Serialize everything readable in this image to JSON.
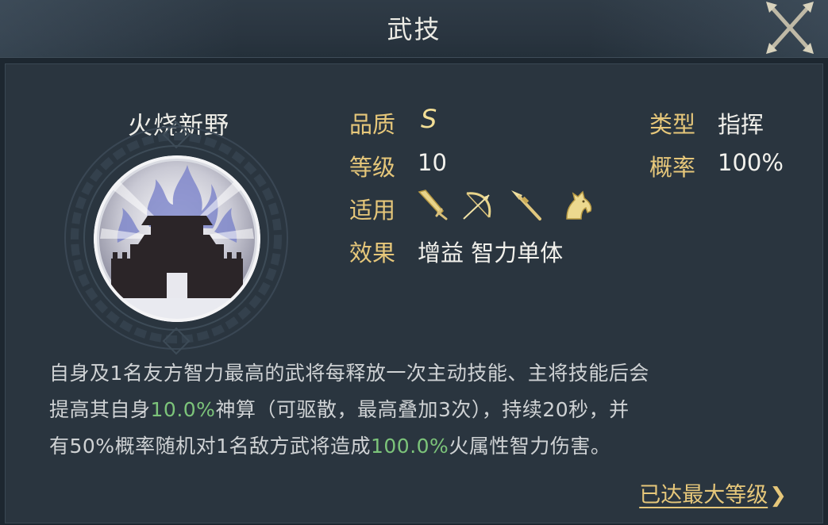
{
  "header": {
    "title": "武技"
  },
  "skill": {
    "name": "火烧新野",
    "quality_label": "品质",
    "quality": "S",
    "level_label": "等级",
    "level": "10",
    "applies_label": "适用",
    "effect_label": "效果",
    "effect": "增益 智力单体",
    "type_label": "类型",
    "type": "指挥",
    "rate_label": "概率",
    "rate": "100%",
    "weapons": [
      "sword-icon",
      "bow-icon",
      "spear-icon",
      "horse-icon"
    ]
  },
  "description": {
    "line1": "自身及1名友方智力最高的武将每释放一次主动技能、主将技能后会",
    "line2_a": "提高其自身",
    "line2_hl": "10.0%",
    "line2_b": "神算（可驱散，最高叠加3次），持续20秒，并",
    "line3_a": "有50%概率随机对1名敌方武将造成",
    "line3_hl": "100.0%",
    "line3_b": "火属性智力伤害。"
  },
  "footer": {
    "max_level_link": "已达最大等级",
    "chevron": "❯"
  },
  "colors": {
    "label_gold": "#e6c77a",
    "highlight_green": "#7cc47a",
    "panel": "#2a353f"
  }
}
